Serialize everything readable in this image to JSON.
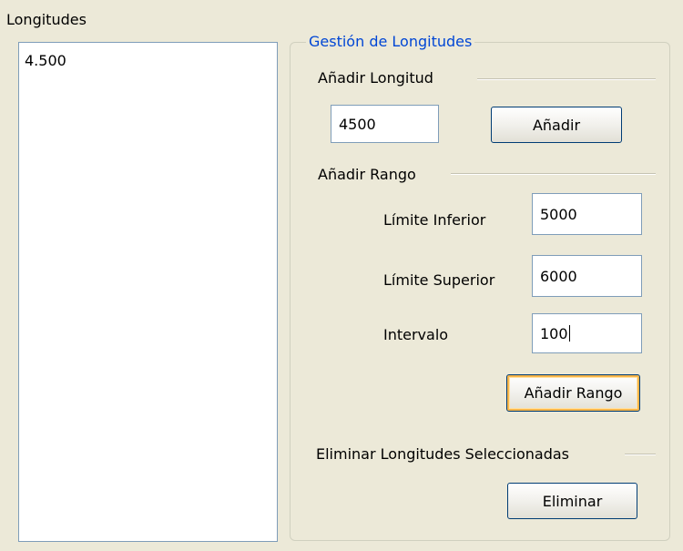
{
  "list_panel": {
    "label": "Longitudes",
    "items": [
      "4.500"
    ]
  },
  "group": {
    "title": "Gestión de Longitudes",
    "add_length": {
      "label": "Añadir Longitud",
      "value": "4500",
      "button": "Añadir"
    },
    "add_range": {
      "label": "Añadir Rango",
      "lower_label": "Límite Inferior",
      "lower_value": "5000",
      "upper_label": "Límite Superior",
      "upper_value": "6000",
      "interval_label": "Intervalo",
      "interval_value": "100",
      "button": "Añadir Rango"
    },
    "delete": {
      "label": "Eliminar Longitudes Seleccionadas",
      "button": "Eliminar"
    }
  },
  "colors": {
    "background": "#ECE9D8",
    "group_title": "#0046D5",
    "input_border": "#7F9DB9",
    "button_focus": "#F9B64A"
  }
}
